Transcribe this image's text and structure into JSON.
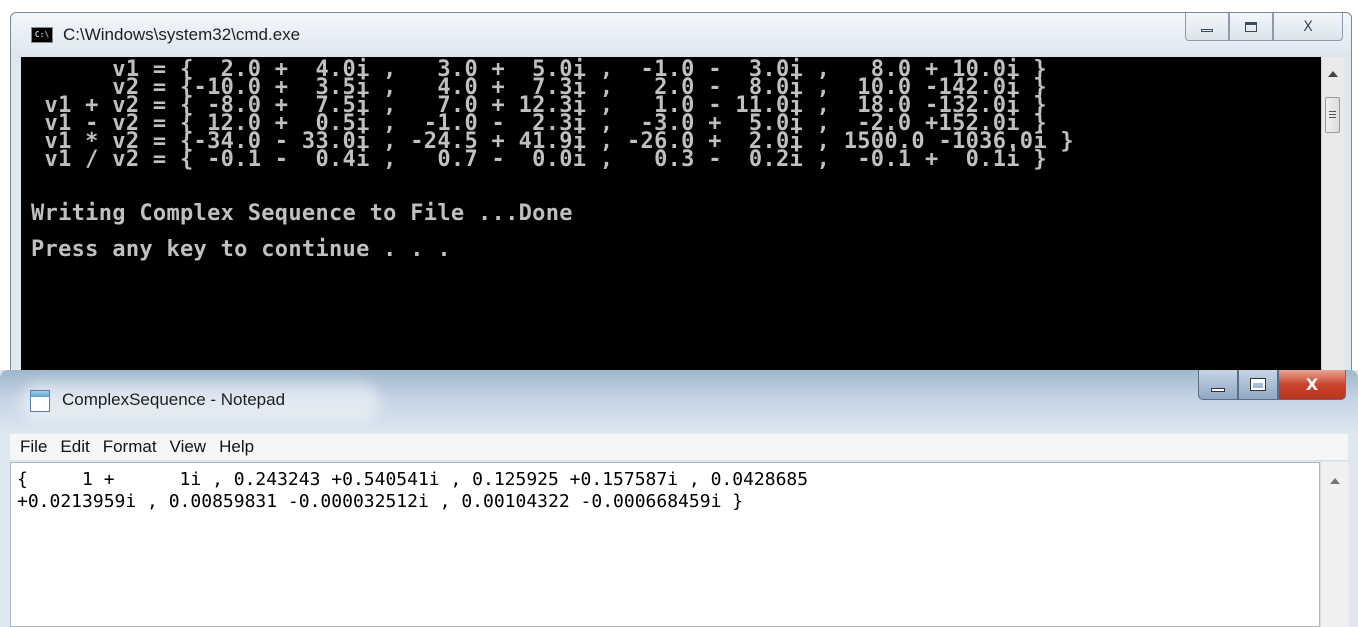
{
  "cmd": {
    "title": "C:\\Windows\\system32\\cmd.exe",
    "icon": "console-icon",
    "output_lines": [
      "      v1 = {  2.0 +  4.0i ,   3.0 +  5.0i ,  -1.0 -  3.0i ,   8.0 + 10.0i }",
      "      v2 = {-10.0 +  3.5i ,   4.0 +  7.3i ,   2.0 -  8.0i ,  10.0 -142.0i }",
      " v1 + v2 = { -8.0 +  7.5i ,   7.0 + 12.3i ,   1.0 - 11.0i ,  18.0 -132.0i }",
      " v1 - v2 = { 12.0 +  0.5i ,  -1.0 -  2.3i ,  -3.0 +  5.0i ,  -2.0 +152.0i }",
      " v1 * v2 = {-34.0 - 33.0i , -24.5 + 41.9i , -26.0 +  2.0i , 1500.0 -1036.0i }",
      " v1 / v2 = { -0.1 -  0.4i ,   0.7 -  0.0i ,   0.3 -  0.2i ,  -0.1 +  0.1i }",
      "",
      "",
      "Writing Complex Sequence to File ...Done",
      "",
      "Press any key to continue . . ."
    ]
  },
  "notepad": {
    "title": "ComplexSequence - Notepad",
    "menu": [
      "File",
      "Edit",
      "Format",
      "View",
      "Help"
    ],
    "content": "{     1 +      1i , 0.243243 +0.540541i , 0.125925 +0.157587i , 0.0428685\n+0.0213959i , 0.00859831 -0.000032512i , 0.00104322 -0.000668459i }",
    "close_glyph": "X"
  }
}
